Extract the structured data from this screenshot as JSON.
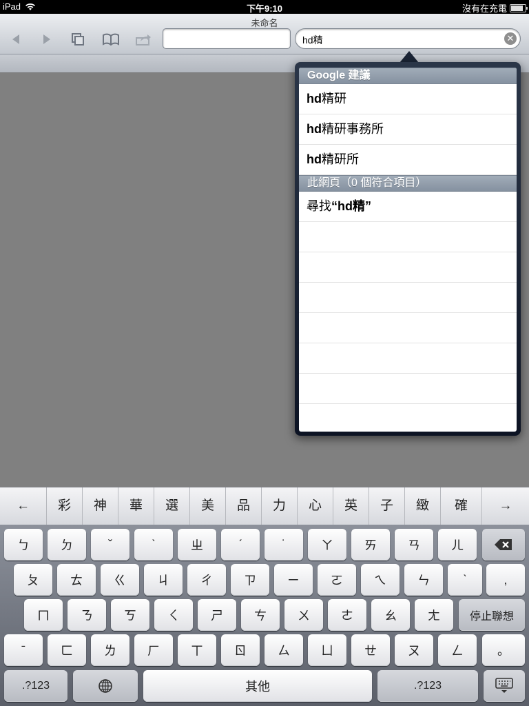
{
  "status_bar": {
    "device": "iPad",
    "time": "下午9:10",
    "charging": "沒有在充電"
  },
  "toolbar": {
    "title": "未命名",
    "url_value": "",
    "search_value": "hd精"
  },
  "suggestions": {
    "google_header": "Google 建議",
    "google_items": [
      "hd精研",
      "hd精研事務所",
      "hd精研所"
    ],
    "page_header": "此網頁（0 個符合項目）",
    "find_prefix": "尋找",
    "find_term": "“hd精”"
  },
  "keyboard": {
    "candidates": [
      "←",
      "彩",
      "神",
      "華",
      "選",
      "美",
      "品",
      "力",
      "心",
      "英",
      "子",
      "緻",
      "確",
      "→"
    ],
    "row1": [
      "ㄅ",
      "ㄉ",
      "ˇ",
      "ˋ",
      "ㄓ",
      "ˊ",
      "˙",
      "ㄚ",
      "ㄞ",
      "ㄢ",
      "ㄦ"
    ],
    "row2": [
      "ㄆ",
      "ㄊ",
      "ㄍ",
      "ㄐ",
      "ㄔ",
      "ㄗ",
      "ㄧ",
      "ㄛ",
      "ㄟ",
      "ㄣ",
      "ˋ",
      ","
    ],
    "row3": [
      "ㄇ",
      "ㄋ",
      "ㄎ",
      "ㄑ",
      "ㄕ",
      "ㄘ",
      "ㄨ",
      "ㄜ",
      "ㄠ",
      "ㄤ"
    ],
    "row3_action": "停止聯想",
    "row4": [
      "ˉ",
      "ㄈ",
      "ㄌ",
      "ㄏ",
      "ㄒ",
      "ㄖ",
      "ㄙ",
      "ㄩ",
      "ㄝ",
      "ㄡ",
      "ㄥ",
      "。"
    ],
    "numbers_label": ".?123",
    "space_label": "其他"
  },
  "icons": [
    "wifi-icon",
    "battery-icon",
    "back-icon",
    "forward-icon",
    "pages-icon",
    "bookmarks-icon",
    "share-icon",
    "clear-icon",
    "delete-icon",
    "globe-icon",
    "hide-keyboard-icon"
  ]
}
